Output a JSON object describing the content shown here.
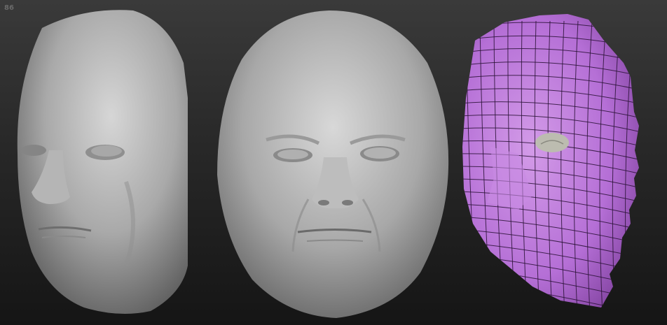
{
  "viewport": {
    "frame_label": "86",
    "background": "#2b2b2b",
    "views": [
      {
        "id": "three-quarter",
        "material": "#bdbdbd"
      },
      {
        "id": "front",
        "material": "#c0c0c0"
      },
      {
        "id": "wireframe",
        "material": "#b56fd6",
        "edge": "#2a1236",
        "eye": "#bcbcb0"
      }
    ]
  }
}
